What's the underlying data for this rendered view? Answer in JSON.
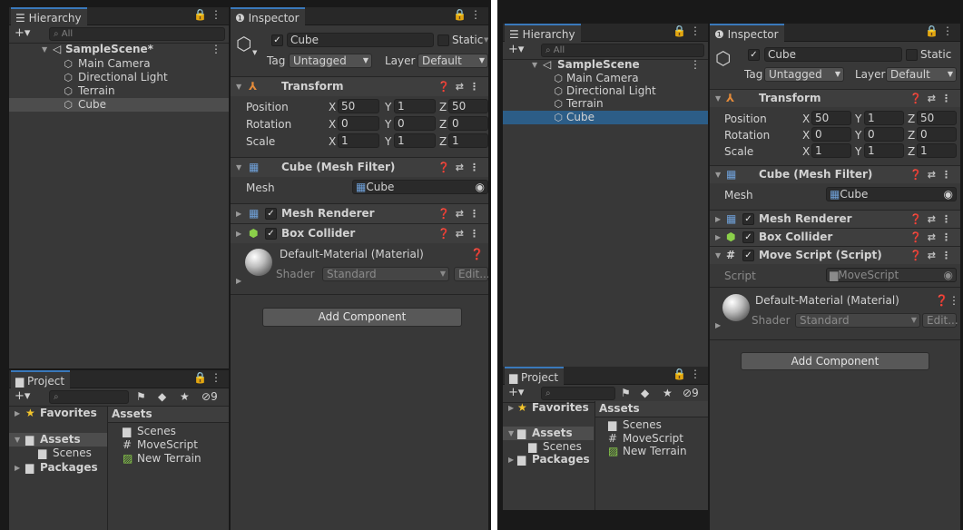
{
  "left": {
    "hierarchy": {
      "tab_label": "Hierarchy",
      "tab_icon": "list-icon",
      "tools": "a ⋮",
      "add_label": "+▾",
      "search_placeholder": "All",
      "scene": "SampleScene*",
      "items": [
        {
          "label": "Main Camera",
          "icon": "cube-icon"
        },
        {
          "label": "Directional Light",
          "icon": "cube-icon"
        },
        {
          "label": "Terrain",
          "icon": "cube-icon"
        },
        {
          "label": "Cube",
          "icon": "cube-icon",
          "selected": true
        }
      ]
    },
    "inspector": {
      "tab_label": "Inspector",
      "object_name": "Cube",
      "static_label": "Static",
      "tag_label": "Tag",
      "tag_value": "Untagged",
      "layer_label": "Layer",
      "layer_value": "Default",
      "transform": {
        "title": "Transform",
        "rows": [
          {
            "label": "Position",
            "x": "50",
            "y": "1",
            "z": "50"
          },
          {
            "label": "Rotation",
            "x": "0",
            "y": "0",
            "z": "0"
          },
          {
            "label": "Scale",
            "x": "1",
            "y": "1",
            "z": "1"
          }
        ]
      },
      "mesh_filter": {
        "title": "Cube (Mesh Filter)",
        "mesh_label": "Mesh",
        "mesh_value": "Cube"
      },
      "components": [
        {
          "title": "Mesh Renderer",
          "enabled": true
        },
        {
          "title": "Box Collider",
          "enabled": true
        }
      ],
      "material": {
        "title": "Default-Material (Material)",
        "shader_label": "Shader",
        "shader_value": "Standard",
        "edit_label": "Edit..."
      },
      "add_component": "Add Component"
    },
    "project": {
      "tab_label": "Project",
      "badge": "9",
      "tree": [
        {
          "label": "Favorites",
          "icon": "star-icon"
        },
        {
          "label": "Assets",
          "icon": "folder-icon"
        },
        {
          "label": "Scenes",
          "icon": "folder-icon"
        },
        {
          "label": "Packages",
          "icon": "folder-icon"
        }
      ],
      "assets_header": "Assets",
      "assets": [
        {
          "label": "Scenes",
          "icon": "folder-icon"
        },
        {
          "label": "MoveScript",
          "icon": "script-icon"
        },
        {
          "label": "New Terrain",
          "icon": "terrain-icon"
        }
      ]
    }
  },
  "right": {
    "hierarchy": {
      "tab_label": "Hierarchy",
      "scene": "SampleScene",
      "search_placeholder": "All",
      "items": [
        {
          "label": "Main Camera"
        },
        {
          "label": "Directional Light"
        },
        {
          "label": "Terrain"
        },
        {
          "label": "Cube",
          "selected": true
        }
      ]
    },
    "inspector": {
      "tab_label": "Inspector",
      "object_name": "Cube",
      "static_label": "Static",
      "tag_label": "Tag",
      "tag_value": "Untagged",
      "layer_label": "Layer",
      "layer_value": "Default",
      "transform": {
        "title": "Transform",
        "rows": [
          {
            "label": "Position",
            "x": "50",
            "y": "1",
            "z": "50"
          },
          {
            "label": "Rotation",
            "x": "0",
            "y": "0",
            "z": "0"
          },
          {
            "label": "Scale",
            "x": "1",
            "y": "1",
            "z": "1"
          }
        ]
      },
      "mesh_filter": {
        "title": "Cube (Mesh Filter)",
        "mesh_label": "Mesh",
        "mesh_value": "Cube"
      },
      "components": [
        {
          "title": "Mesh Renderer",
          "enabled": true
        },
        {
          "title": "Box Collider",
          "enabled": true
        },
        {
          "title": "Move Script (Script)",
          "enabled": true
        }
      ],
      "script_label": "Script",
      "script_value": "MoveScript",
      "material": {
        "title": "Default-Material (Material)",
        "shader_label": "Shader",
        "shader_value": "Standard",
        "edit_label": "Edit..."
      },
      "add_component": "Add Component"
    },
    "project": {
      "tab_label": "Project",
      "badge": "9",
      "tree": [
        {
          "label": "Favorites"
        },
        {
          "label": "Assets"
        },
        {
          "label": "Scenes"
        },
        {
          "label": "Packages"
        }
      ],
      "assets_header": "Assets",
      "assets": [
        {
          "label": "Scenes"
        },
        {
          "label": "MoveScript"
        },
        {
          "label": "New Terrain"
        }
      ]
    }
  },
  "colors": {
    "selection": "#2c5d87",
    "tab_accent": "#3a79bb",
    "panel": "#383838"
  }
}
